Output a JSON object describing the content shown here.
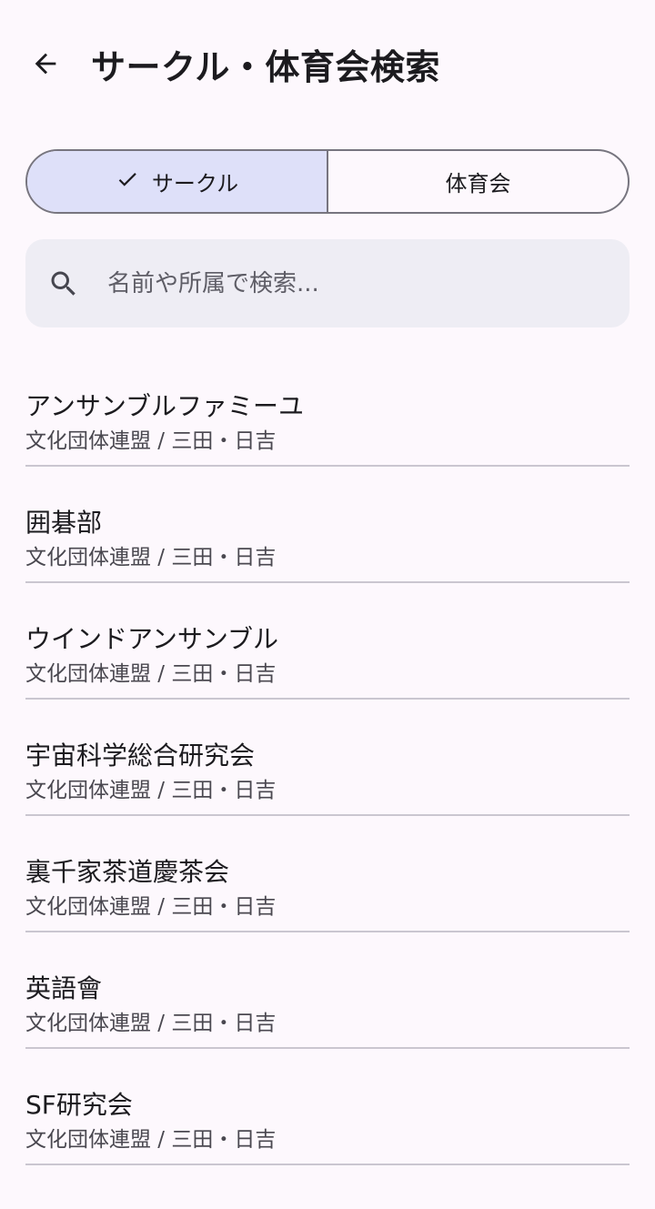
{
  "header": {
    "title": "サークル・体育会検索",
    "back_icon": "arrow-left-icon"
  },
  "segmented": {
    "options": [
      {
        "label": "サークル",
        "selected": true
      },
      {
        "label": "体育会",
        "selected": false
      }
    ],
    "selected_color": "#DEE0F9"
  },
  "search": {
    "placeholder": "名前や所属で検索...",
    "value": "",
    "icon": "search-icon"
  },
  "results": [
    {
      "name": "アンサンブルファミーユ",
      "meta": "文化団体連盟 / 三田・日吉"
    },
    {
      "name": "囲碁部",
      "meta": "文化団体連盟 / 三田・日吉"
    },
    {
      "name": "ウインドアンサンブル",
      "meta": "文化団体連盟 / 三田・日吉"
    },
    {
      "name": "宇宙科学総合研究会",
      "meta": "文化団体連盟 / 三田・日吉"
    },
    {
      "name": "裏千家茶道慶茶会",
      "meta": "文化団体連盟 / 三田・日吉"
    },
    {
      "name": "英語會",
      "meta": "文化団体連盟 / 三田・日吉"
    },
    {
      "name": "SF研究会",
      "meta": "文化団体連盟 / 三田・日吉"
    }
  ]
}
